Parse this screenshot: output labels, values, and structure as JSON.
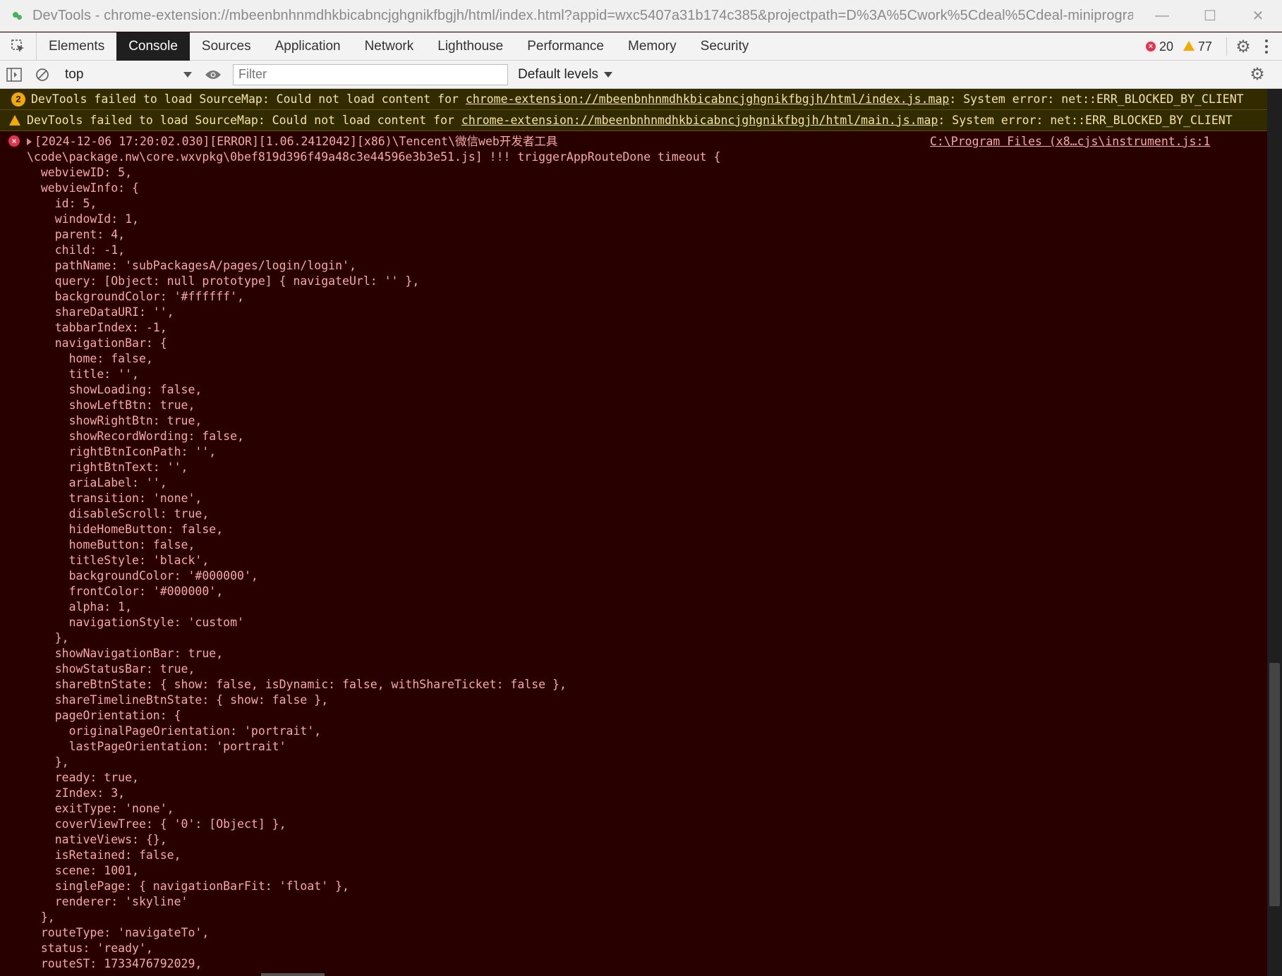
{
  "window": {
    "title": "DevTools - chrome-extension://mbeenbnhnmdhkbicabncjghgnikfbgjh/html/index.html?appid=wxc5407a31b174c385&projectpath=D%3A%5Cwork%5Cdeal%5Cdeal-miniprogram...",
    "minimize": "—",
    "maximize": "☐",
    "close": "✕"
  },
  "tabs": [
    "Elements",
    "Console",
    "Sources",
    "Application",
    "Network",
    "Lighthouse",
    "Performance",
    "Memory",
    "Security"
  ],
  "active_tab": "Console",
  "counts": {
    "errors": "20",
    "warnings": "77"
  },
  "toolbar": {
    "context": "top",
    "filter_placeholder": "Filter",
    "levels": "Default levels"
  },
  "warnings": [
    {
      "badge": "2",
      "prefix": "DevTools failed to load SourceMap: Could not load content for ",
      "link": "chrome-extension://mbeenbnhnmdhkbicabncjghgnikfbgjh/html/index.js.map",
      "suffix": ": System error: net::ERR_BLOCKED_BY_CLIENT"
    },
    {
      "prefix": "DevTools failed to load SourceMap: Could not load content for ",
      "link": "chrome-extension://mbeenbnhnmdhkbicabncjghgnikfbgjh/html/main.js.map",
      "suffix": ": System error: net::ERR_BLOCKED_BY_CLIENT"
    }
  ],
  "error": {
    "head": "[2024-12-06 17:20:02.030][ERROR][1.06.2412042][x86)\\Tencent\\微信web开发者工具",
    "source": "C:\\Program Files (x8…cjs\\instrument.js:1",
    "line2": "\\code\\package.nw\\core.wxvpkg\\0bef819d396f49a48c3e44596e3b3e51.js] !!! triggerAppRouteDone timeout {",
    "body": "  webviewID: 5,\n  webviewInfo: {\n    id: 5,\n    windowId: 1,\n    parent: 4,\n    child: -1,\n    pathName: 'subPackagesA/pages/login/login',\n    query: [Object: null prototype] { navigateUrl: '' },\n    backgroundColor: '#ffffff',\n    shareDataURI: '',\n    tabbarIndex: -1,\n    navigationBar: {\n      home: false,\n      title: '',\n      showLoading: false,\n      showLeftBtn: true,\n      showRightBtn: true,\n      showRecordWording: false,\n      rightBtnIconPath: '',\n      rightBtnText: '',\n      ariaLabel: '',\n      transition: 'none',\n      disableScroll: true,\n      hideHomeButton: false,\n      homeButton: false,\n      titleStyle: 'black',\n      backgroundColor: '#000000',\n      frontColor: '#000000',\n      alpha: 1,\n      navigationStyle: 'custom'\n    },\n    showNavigationBar: true,\n    showStatusBar: true,\n    shareBtnState: { show: false, isDynamic: false, withShareTicket: false },\n    shareTimelineBtnState: { show: false },\n    pageOrientation: {\n      originalPageOrientation: 'portrait',\n      lastPageOrientation: 'portrait'\n    },\n    ready: true,\n    zIndex: 3,\n    exitType: 'none',\n    coverViewTree: { '0': [Object] },\n    nativeViews: {},\n    isRetained: false,\n    scene: 1001,\n    singlePage: { navigationBarFit: 'float' },\n    renderer: 'skyline'\n  },\n  routeType: 'navigateTo',\n  status: 'ready',\n  routeST: 1733476792029,"
  }
}
